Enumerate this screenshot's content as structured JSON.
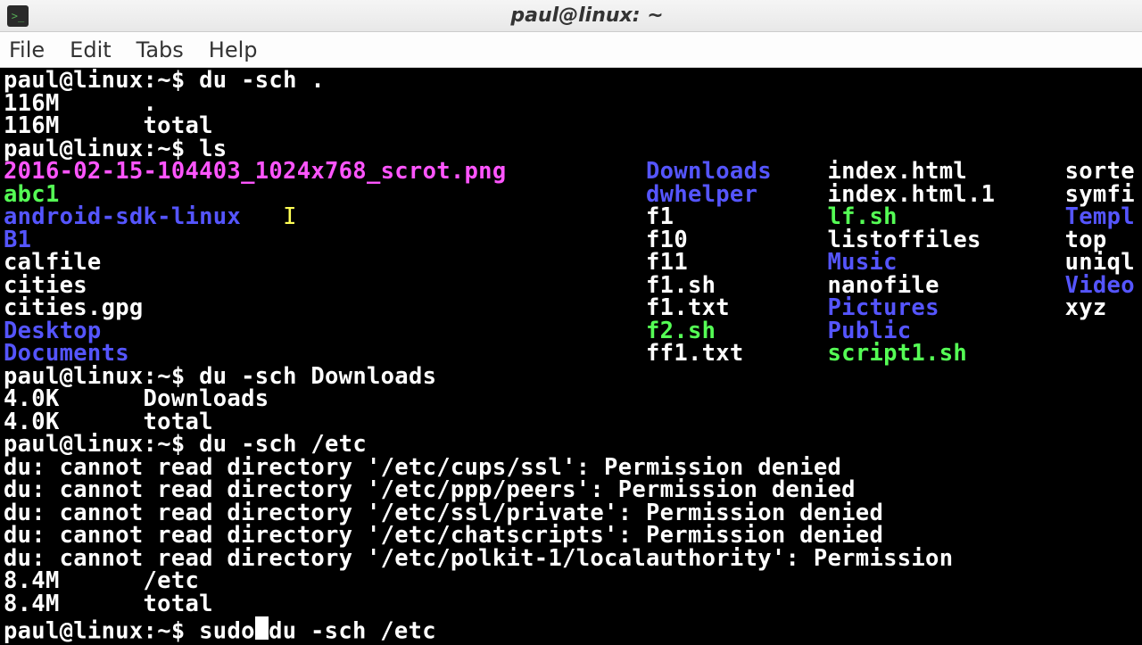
{
  "window": {
    "title": "paul@linux: ~"
  },
  "menubar": {
    "file": "File",
    "edit": "Edit",
    "tabs": "Tabs",
    "help": "Help"
  },
  "prompt": {
    "user_host": "paul@linux",
    "path": "~",
    "sigil": "$"
  },
  "commands": {
    "du_here": "du -sch .",
    "ls": "ls",
    "du_downloads": "du -sch Downloads",
    "du_etc": "du -sch /etc",
    "sudo_du_etc_before": "sudo",
    "sudo_du_etc_after": "du -sch /etc"
  },
  "du_here_out": {
    "size": "116M",
    "name": ".",
    "total_size": "116M",
    "total_label": "total"
  },
  "ls_cols": [
    [
      {
        "t": "2016-02-15-104403_1024x768_scrot.png",
        "c": "magenta"
      },
      {
        "t": "abc1",
        "c": "green"
      },
      {
        "t": "android-sdk-linux",
        "c": "blue"
      },
      {
        "t": "B1",
        "c": "blue"
      },
      {
        "t": "calfile",
        "c": "white"
      },
      {
        "t": "cities",
        "c": "white"
      },
      {
        "t": "cities.gpg",
        "c": "white"
      },
      {
        "t": "Desktop",
        "c": "blue"
      },
      {
        "t": "Documents",
        "c": "blue"
      }
    ],
    [
      {
        "t": "Downloads",
        "c": "blue"
      },
      {
        "t": "dwhelper",
        "c": "blue"
      },
      {
        "t": "f1",
        "c": "white"
      },
      {
        "t": "f10",
        "c": "white"
      },
      {
        "t": "f11",
        "c": "white"
      },
      {
        "t": "f1.sh",
        "c": "white"
      },
      {
        "t": "f1.txt",
        "c": "white"
      },
      {
        "t": "f2.sh",
        "c": "green"
      },
      {
        "t": "ff1.txt",
        "c": "white"
      }
    ],
    [
      {
        "t": "index.html",
        "c": "white"
      },
      {
        "t": "index.html.1",
        "c": "white"
      },
      {
        "t": "lf.sh",
        "c": "green"
      },
      {
        "t": "listoffiles",
        "c": "white"
      },
      {
        "t": "Music",
        "c": "blue"
      },
      {
        "t": "nanofile",
        "c": "white"
      },
      {
        "t": "Pictures",
        "c": "blue"
      },
      {
        "t": "Public",
        "c": "blue"
      },
      {
        "t": "script1.sh",
        "c": "green"
      }
    ],
    [
      {
        "t": "sorte",
        "c": "white"
      },
      {
        "t": "symfi",
        "c": "white"
      },
      {
        "t": "Templ",
        "c": "blue"
      },
      {
        "t": "top",
        "c": "white"
      },
      {
        "t": "uniql",
        "c": "white"
      },
      {
        "t": "Video",
        "c": "blue"
      },
      {
        "t": "xyz",
        "c": "white"
      },
      {
        "t": "",
        "c": "white"
      },
      {
        "t": "",
        "c": "white"
      }
    ]
  ],
  "du_downloads_out": {
    "size": "4.0K",
    "name": "Downloads",
    "total_size": "4.0K",
    "total_label": "total"
  },
  "du_etc_errors": [
    "du: cannot read directory '/etc/cups/ssl': Permission denied",
    "du: cannot read directory '/etc/ppp/peers': Permission denied",
    "du: cannot read directory '/etc/ssl/private': Permission denied",
    "du: cannot read directory '/etc/chatscripts': Permission denied",
    "du: cannot read directory '/etc/polkit-1/localauthority': Permission"
  ],
  "du_etc_out": {
    "size": "8.4M",
    "name": "/etc",
    "total_size": "8.4M",
    "total_label": "total"
  },
  "ls_col_widths": [
    46,
    13,
    17,
    8
  ]
}
